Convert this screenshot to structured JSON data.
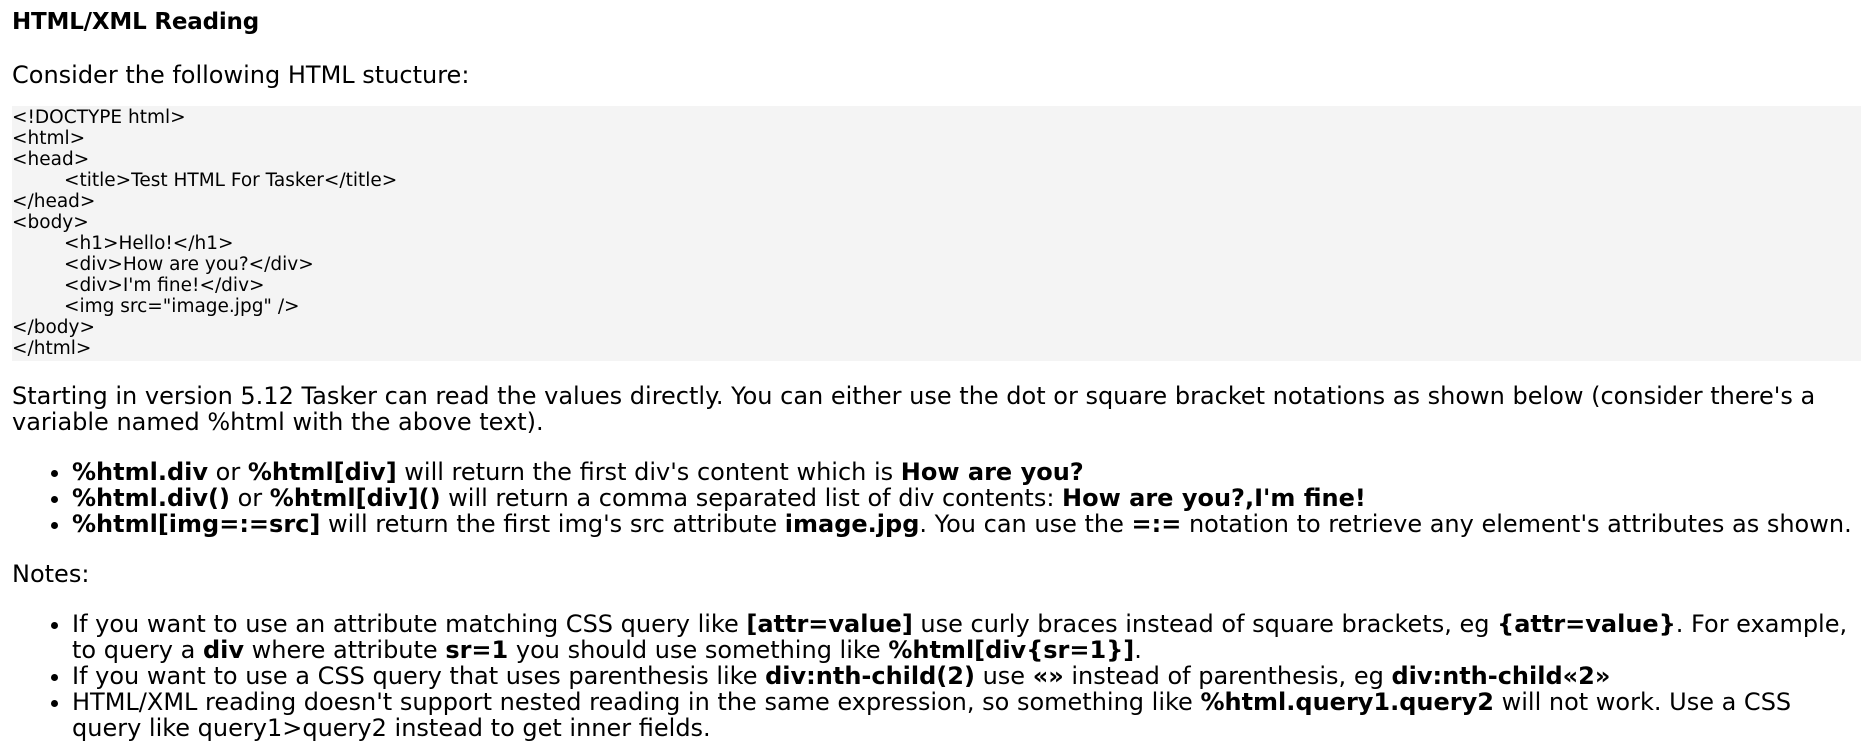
{
  "title": "HTML/XML Reading",
  "intro": "Consider the following HTML stucture:",
  "code_lines": [
    {
      "text": "<!DOCTYPE html>",
      "indent": false
    },
    {
      "text": "<html>",
      "indent": false
    },
    {
      "text": "<head>",
      "indent": false
    },
    {
      "text": "<title>Test HTML For Tasker</title>",
      "indent": true
    },
    {
      "text": "</head>",
      "indent": false
    },
    {
      "text": "<body>",
      "indent": false
    },
    {
      "text": "<h1>Hello!</h1>",
      "indent": true
    },
    {
      "text": "<div>How are you?</div>",
      "indent": true
    },
    {
      "text": "<div>I'm fine!</div>",
      "indent": true
    },
    {
      "text": "<img src=\"image.jpg\" />",
      "indent": true
    },
    {
      "text": "</body>",
      "indent": false
    },
    {
      "text": "</html>",
      "indent": false
    }
  ],
  "description": "Starting in version 5.12 Tasker can read the values directly. You can either use the dot or square bracket notations as shown below (consider there's a variable named %html with the above text).",
  "features": [
    [
      {
        "t": "%html.div",
        "b": true
      },
      {
        "t": " or ",
        "b": false
      },
      {
        "t": "%html[div]",
        "b": true
      },
      {
        "t": " will return the first div's content which is ",
        "b": false
      },
      {
        "t": "How are you?",
        "b": true
      }
    ],
    [
      {
        "t": "%html.div()",
        "b": true
      },
      {
        "t": " or ",
        "b": false
      },
      {
        "t": "%html[div]()",
        "b": true
      },
      {
        "t": " will return a comma separated list of div contents: ",
        "b": false
      },
      {
        "t": "How are you?,I'm fine!",
        "b": true
      }
    ],
    [
      {
        "t": "%html[img=:=src]",
        "b": true
      },
      {
        "t": " will return the first img's src attribute ",
        "b": false
      },
      {
        "t": "image.jpg",
        "b": true
      },
      {
        "t": ". You can use the ",
        "b": false
      },
      {
        "t": "=:=",
        "b": true
      },
      {
        "t": " notation to retrieve any element's attributes as shown.",
        "b": false
      }
    ]
  ],
  "notes_heading": "Notes:",
  "notes": [
    [
      {
        "t": "If you want to use an attribute matching CSS query like ",
        "b": false
      },
      {
        "t": "[attr=value]",
        "b": true
      },
      {
        "t": " use curly braces instead of square brackets, eg ",
        "b": false
      },
      {
        "t": "{attr=value}",
        "b": true
      },
      {
        "t": ". For example, to query a ",
        "b": false
      },
      {
        "t": "div",
        "b": true
      },
      {
        "t": " where attribute ",
        "b": false
      },
      {
        "t": "sr=1",
        "b": true
      },
      {
        "t": " you should use something like ",
        "b": false
      },
      {
        "t": "%html[div{sr=1}]",
        "b": true
      },
      {
        "t": ".",
        "b": false
      }
    ],
    [
      {
        "t": "If you want to use a CSS query that uses parenthesis like ",
        "b": false
      },
      {
        "t": "div:nth-child(2)",
        "b": true
      },
      {
        "t": " use ",
        "b": false
      },
      {
        "t": "«»",
        "b": true
      },
      {
        "t": " instead of parenthesis, eg ",
        "b": false
      },
      {
        "t": "div:nth-child«2»",
        "b": true
      }
    ],
    [
      {
        "t": "HTML/XML reading doesn't support nested reading in the same expression, so something like ",
        "b": false
      },
      {
        "t": "%html.query1.query2",
        "b": true
      },
      {
        "t": " will not work. Use a CSS query like query1>query2 instead to get inner fields.",
        "b": false
      }
    ]
  ]
}
